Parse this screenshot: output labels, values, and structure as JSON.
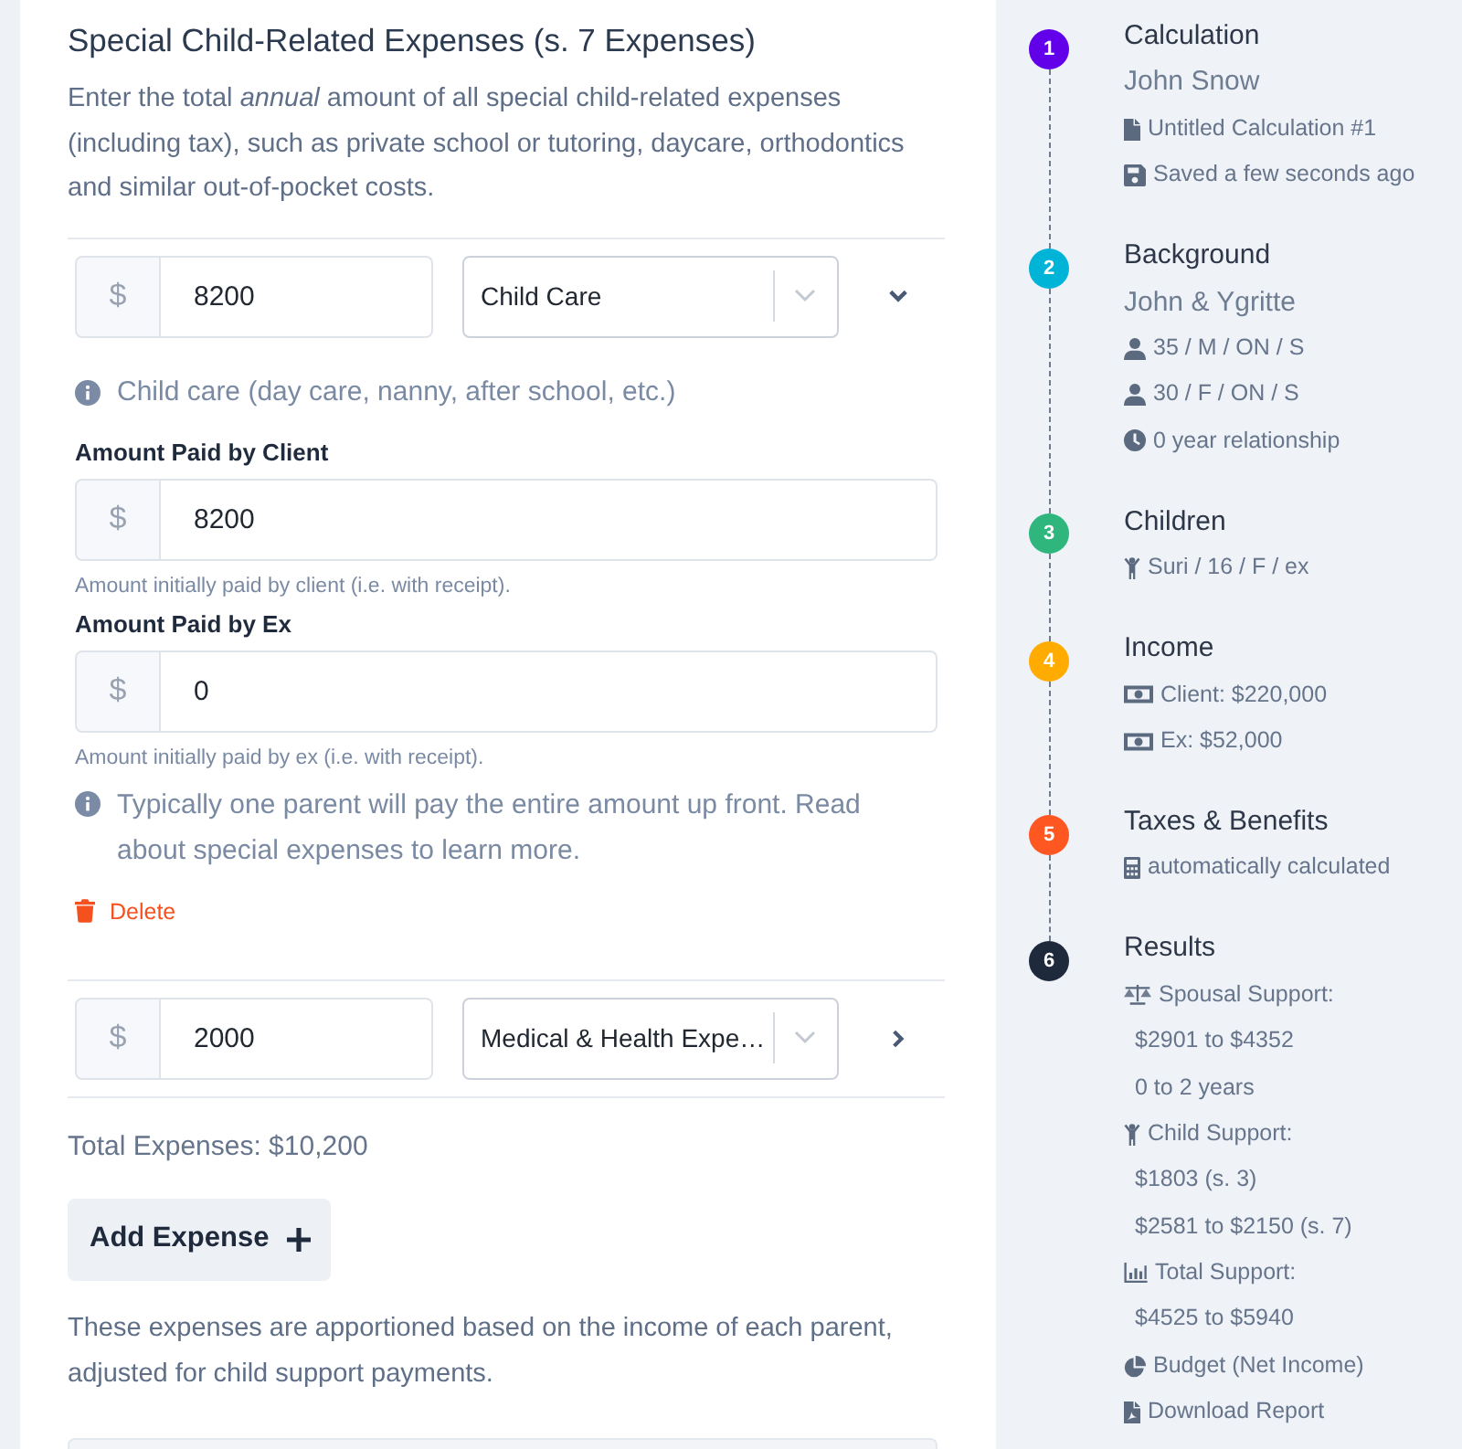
{
  "section": {
    "title": "Special Child-Related Expenses (s. 7 Expenses)",
    "intro": "Enter the total *annual* amount of all special child-related expenses (including tax), such as private school or tutoring, daycare, orthodontics and similar out-of-pocket costs."
  },
  "expenses": [
    {
      "currency": "$",
      "amount": "8200",
      "category": "Child Care",
      "expanded": true,
      "info": "Child care (day care, nanny, after school, etc.)",
      "fields": [
        {
          "label": "Amount Paid by Client",
          "currency": "$",
          "value": "8200",
          "help": "Amount initially paid by client (i.e. with receipt)."
        },
        {
          "label": "Amount Paid by Ex",
          "currency": "$",
          "value": "0",
          "help": "Amount initially paid by ex (i.e. with receipt)."
        }
      ],
      "note": "Typically one parent will pay the entire amount up front. Read about special expenses to learn more.",
      "delete_label": "Delete"
    },
    {
      "currency": "$",
      "amount": "2000",
      "category": "Medical & Health Expe…",
      "expanded": false
    }
  ],
  "total": "Total Expenses: $10,200",
  "add_button": "Add Expense",
  "footer_note": "These expenses are apportioned based on the income of each parent, adjusted for child support payments.",
  "steps": [
    {
      "number": "1",
      "color": "#6200ea",
      "title": "Calculation",
      "subtitle": "John Snow",
      "lines": [
        {
          "kind": "file",
          "text": "Untitled Calculation #1"
        },
        {
          "kind": "save",
          "text": "Saved a few seconds ago"
        }
      ]
    },
    {
      "number": "2",
      "color": "#00b4d8",
      "title": "Background",
      "subtitle": "John & Ygritte",
      "lines": [
        {
          "kind": "person",
          "text": "35 / M / ON / S"
        },
        {
          "kind": "person",
          "text": "30 / F / ON / S"
        },
        {
          "kind": "clock",
          "text": "0 year relationship"
        }
      ]
    },
    {
      "number": "3",
      "color": "#2eb67d",
      "title": "Children",
      "lines": [
        {
          "kind": "child",
          "text": "Suri / 16 / F / ex"
        }
      ]
    },
    {
      "number": "4",
      "color": "#ffab00",
      "title": "Income",
      "lines": [
        {
          "kind": "cash",
          "text": "Client: $220,000"
        },
        {
          "kind": "cash",
          "text": "Ex: $52,000"
        }
      ]
    },
    {
      "number": "5",
      "color": "#ff5722",
      "title": "Taxes & Benefits",
      "lines": [
        {
          "kind": "calculator",
          "text": "automatically calculated"
        }
      ]
    },
    {
      "number": "6",
      "color": "#1e2a3b",
      "title": "Results",
      "lines": [
        {
          "kind": "scale",
          "text": "Spousal Support:"
        },
        {
          "kind": "value",
          "text": "$2901 to $4352"
        },
        {
          "kind": "value",
          "text": "0 to 2 years"
        },
        {
          "kind": "child",
          "text": "Child Support:"
        },
        {
          "kind": "value",
          "text": "$1803 (s. 3)"
        },
        {
          "kind": "value",
          "text": "$2581 to $2150 (s. 7)"
        },
        {
          "kind": "chart",
          "text": "Total Support:"
        },
        {
          "kind": "value",
          "text": "$4525 to $5940"
        },
        {
          "kind": "pie",
          "text": "Budget (Net Income)"
        },
        {
          "kind": "pdf",
          "text": "Download Report"
        }
      ]
    }
  ]
}
